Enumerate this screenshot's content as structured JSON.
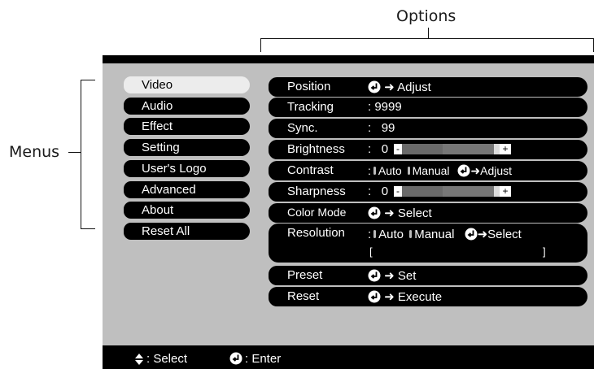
{
  "annotations": {
    "options": "Options",
    "menus": "Menus"
  },
  "menu": [
    {
      "label": "Video"
    },
    {
      "label": "Audio"
    },
    {
      "label": "Effect"
    },
    {
      "label": "Setting"
    },
    {
      "label": "User's Logo"
    },
    {
      "label": "Advanced"
    },
    {
      "label": "About"
    },
    {
      "label": "Reset All"
    }
  ],
  "options": {
    "position": {
      "label": "Position",
      "value": "Adjust"
    },
    "tracking": {
      "label": "Tracking",
      "value": ": 9999"
    },
    "sync": {
      "label": "Sync.",
      "colon": ":",
      "value": "99"
    },
    "brightness": {
      "label": "Brightness",
      "colon": ":",
      "value": "0",
      "minus": "-",
      "plus": "+"
    },
    "contrast": {
      "label": "Contrast",
      "colon": ":",
      "auto": "Auto",
      "manual": "Manual",
      "action": "Adjust"
    },
    "sharpness": {
      "label": "Sharpness",
      "colon": ":",
      "value": "0",
      "minus": "-",
      "plus": "+"
    },
    "color_mode": {
      "label": "Color Mode",
      "action": "Select"
    },
    "resolution": {
      "label": "Resolution",
      "colon": ":",
      "auto": "Auto",
      "manual": "Manual",
      "action": "Select",
      "bracket_open": "[",
      "bracket_close": "]"
    },
    "preset": {
      "label": "Preset",
      "action": "Set"
    },
    "reset": {
      "label": "Reset",
      "action": "Execute"
    }
  },
  "footer": {
    "select": ": Select",
    "enter": ": Enter"
  },
  "colors": {
    "screen": "#000000",
    "panel": "#bfbfbf",
    "active_menu": "#ececec"
  }
}
